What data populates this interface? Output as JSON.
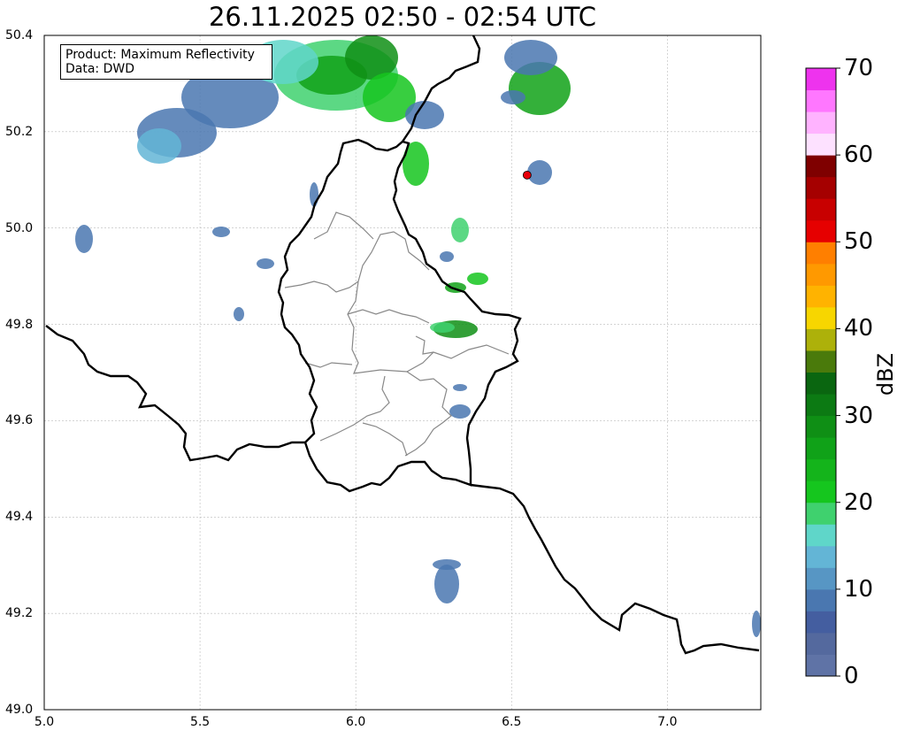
{
  "title": "26.11.2025 02:50 - 02:54 UTC",
  "info_box": {
    "product_line": "Product: Maximum Reflectivity",
    "data_line": "Data: DWD"
  },
  "map": {
    "lon_range": [
      5.0,
      7.3
    ],
    "lat_range": [
      49.0,
      50.4
    ],
    "x_ticks": [
      "5.0",
      "5.5",
      "6.0",
      "6.5",
      "7.0"
    ],
    "y_ticks": [
      "49.0",
      "49.2",
      "49.4",
      "49.6",
      "49.8",
      "50.0",
      "50.2",
      "50.4"
    ],
    "grid": true,
    "marker": {
      "lon": 6.55,
      "lat": 50.11,
      "color": "#e8000b"
    }
  },
  "colorbar": {
    "label": "dBZ",
    "ticks": [
      "0",
      "10",
      "20",
      "30",
      "40",
      "50",
      "60",
      "70"
    ],
    "min": 0,
    "max": 70,
    "bin_colors": [
      "#5f73a6",
      "#54699e",
      "#445ea0",
      "#4a77b0",
      "#5796c4",
      "#63b5d6",
      "#5fd6c9",
      "#3fd16e",
      "#15c61e",
      "#14b41b",
      "#10a218",
      "#0f8f15",
      "#0c7a13",
      "#0a6610",
      "#4a7a0b",
      "#adb10a",
      "#f7d600",
      "#ffb300",
      "#ff9900",
      "#ff7f00",
      "#e60000",
      "#c80000",
      "#a50000",
      "#7f0000",
      "#fde1ff",
      "#ffb3ff",
      "#ff77ff",
      "#ee33ee"
    ]
  }
}
